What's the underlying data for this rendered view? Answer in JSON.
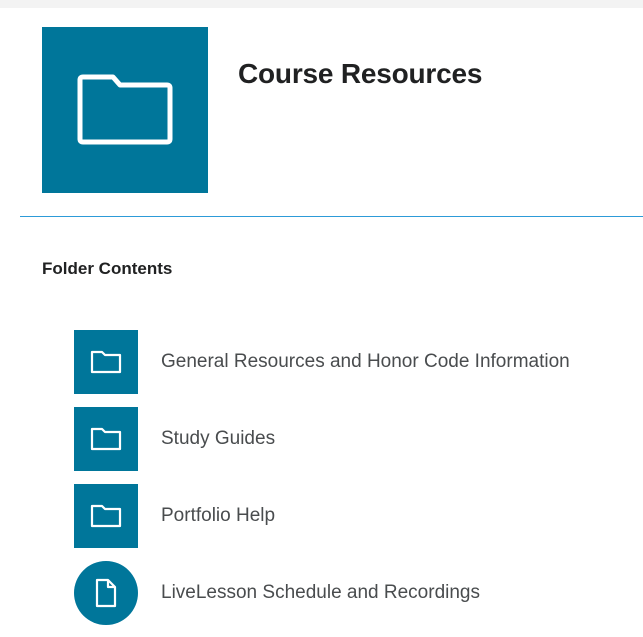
{
  "header": {
    "title": "Course Resources",
    "icon": "folder-icon",
    "tile_color": "#00769a"
  },
  "contents": {
    "heading": "Folder Contents",
    "items": [
      {
        "label": "General Resources and Honor Code Information",
        "icon": "folder-icon"
      },
      {
        "label": "Study Guides",
        "icon": "folder-icon"
      },
      {
        "label": "Portfolio Help",
        "icon": "folder-icon"
      },
      {
        "label": "LiveLesson Schedule and Recordings",
        "icon": "document-icon"
      }
    ]
  },
  "colors": {
    "accent": "#00769a",
    "divider": "#2d9bd8"
  }
}
